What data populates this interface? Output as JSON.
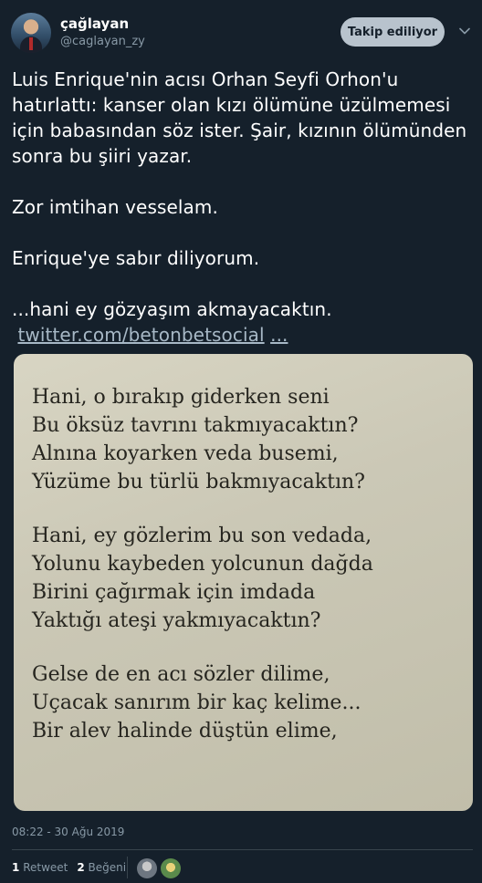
{
  "user": {
    "display_name": "çağlayan",
    "handle": "@caglayan_zy",
    "follow_label": "Takip ediliyor"
  },
  "tweet": {
    "line1": "Luis Enrique'nin acısı Orhan Seyfi Orhon'u hatırlattı: kanser olan kızı ölümüne üzülmemesi için babasından söz ister. Şair, kızının ölümünden sonra bu şiiri yazar.",
    "line2": "Zor imtihan vesselam.",
    "line3": "Enrique'ye sabır diliyorum.",
    "line4": "...hani ey gözyaşım akmayacaktın.",
    "link_text": "twitter.com/betonbetsocial",
    "ellipsis": "..."
  },
  "poem": {
    "stanza1": [
      "Hani, o bırakıp giderken seni",
      "Bu öksüz tavrını takmıyacaktın?",
      "Alnına koyarken veda busemi,",
      "Yüzüme bu türlü bakmıyacaktın?"
    ],
    "stanza2": [
      "Hani, ey gözlerim bu son vedada,",
      "Yolunu kaybeden yolcunun dağda",
      "Birini çağırmak için imdada",
      "Yaktığı ateşi yakmıyacaktın?"
    ],
    "stanza3": [
      "Gelse de en acı sözler dilime,",
      "Uçacak sanırım bir kaç kelime...",
      "Bir alev halinde düştün elime,"
    ]
  },
  "meta": {
    "timestamp": "08:22 - 30 Ağu 2019",
    "retweet_count": "1",
    "retweet_label": "Retweet",
    "like_count": "2",
    "like_label": "Beğeni"
  },
  "colors": {
    "background": "#15202b",
    "secondary_text": "#8899a6",
    "follow_button": "#b8c3cd"
  },
  "icons": {
    "more": "chevron-down-icon"
  }
}
